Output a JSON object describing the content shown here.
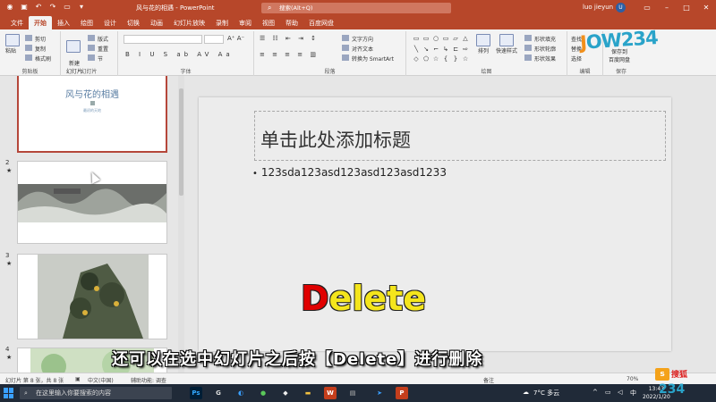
{
  "titlebar": {
    "doc_title": "风与花的相遇 - PowerPoint",
    "search_placeholder": "搜索(Alt+Q)",
    "user_name": "luo jieyun",
    "avatar_letter": "U"
  },
  "tabs": [
    "文件",
    "开始",
    "插入",
    "绘图",
    "设计",
    "切换",
    "动画",
    "幻灯片放映",
    "录制",
    "审阅",
    "视图",
    "帮助",
    "百度网盘"
  ],
  "active_tab": "开始",
  "ribbon": {
    "clipboard": {
      "paste": "粘贴",
      "cut": "剪切",
      "copy": "复制",
      "format_painter": "格式刷",
      "label": "剪贴板"
    },
    "slides": {
      "new_slide": "新建\n幻灯片",
      "layout": "版式",
      "reset": "重置",
      "section": "节",
      "label": "幻灯片"
    },
    "font": {
      "label": "字体"
    },
    "paragraph": {
      "text_direction": "文字方向",
      "align_text": "对齐文本",
      "smartart": "转换为 SmartArt",
      "label": "段落"
    },
    "drawing": {
      "arrange": "排列",
      "quick_styles": "快速样式",
      "shape_fill": "形状填充",
      "shape_outline": "形状轮廓",
      "shape_effects": "形状效果",
      "label": "绘图"
    },
    "editing": {
      "find": "查找",
      "replace": "替换",
      "select": "选择",
      "label": "编辑"
    },
    "save": {
      "save_to": "保存到\n百度网盘",
      "label": "保存"
    }
  },
  "watermark": "JOW234",
  "thumbnails": [
    {
      "num": "",
      "title": "风与花的相遇",
      "subtitle": "最初的天地"
    },
    {
      "num": "2",
      "star": "★"
    },
    {
      "num": "3",
      "star": "★"
    },
    {
      "num": "4",
      "star": "★"
    }
  ],
  "slide": {
    "title_placeholder": "单击此处添加标题",
    "bullet_text": "123sda123asd123asd123asd1233"
  },
  "overlay_word": {
    "first": "D",
    "rest": "elete"
  },
  "caption": "还可以在选中幻灯片之后按【Delete】进行删除",
  "statusbar": {
    "slide_count": "幻灯片 第 8 张，共 8 张",
    "language": "中文(中国)",
    "accessibility": "辅助功能: 调查",
    "notes": "备注",
    "zoom": "70%"
  },
  "taskbar": {
    "search_placeholder": "在这里输入你要搜索的内容",
    "weather": "7°C  多云",
    "ime": "中",
    "time": "13:43",
    "date": "2022/1/20"
  },
  "sohu": {
    "letter": "s",
    "brand": "搜狐",
    "num": "234"
  },
  "colors": {
    "accent": "#b7472a",
    "taskbar": "#202a38",
    "overlay_text": "#f4e51c",
    "overlay_first": "#e00000"
  }
}
